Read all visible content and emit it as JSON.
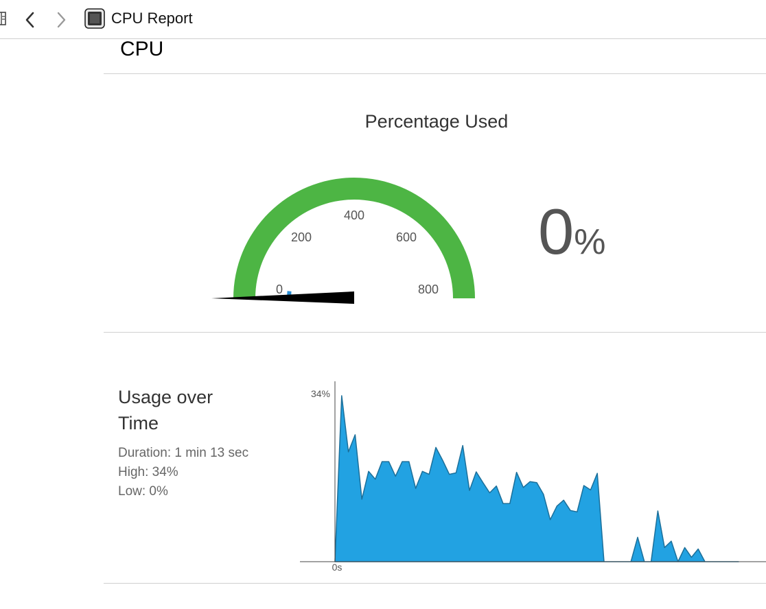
{
  "toolbar": {
    "breadcrumb": "CPU Report",
    "icons": [
      "sidebar-toggle-icon",
      "back-chevron-icon",
      "forward-chevron-icon",
      "cpu-chip-icon"
    ]
  },
  "section": {
    "title": "CPU"
  },
  "gauge": {
    "title": "Percentage Used",
    "min": 0,
    "max": 800,
    "ticks": [
      "0",
      "200",
      "400",
      "600",
      "800"
    ],
    "current_value": 0,
    "value_text": "0",
    "unit": "%",
    "arc_color": "#4db544",
    "needle_color": "#000000",
    "marker_color": "#2a8fd6"
  },
  "usage": {
    "title": "Usage over Time",
    "duration": "Duration: 1 min 13 sec",
    "high": "High: 34%",
    "low": "Low: 0%"
  },
  "chart_data": {
    "type": "area",
    "title": "",
    "xlabel": "",
    "ylabel": "",
    "x_tick_label": "0s",
    "y_tick_label": "34%",
    "ylim": [
      0,
      34
    ],
    "fill_color": "#22a2e2",
    "stroke_color": "#1b6f9a",
    "series": [
      {
        "values": [
          0,
          34,
          22.5,
          26,
          12.8,
          18.5,
          16.9,
          20.5,
          20.5,
          17.5,
          20.5,
          20.5,
          15,
          18.5,
          17.9,
          23.4,
          20.8,
          17.9,
          18.2,
          23.8,
          14.6,
          18.4,
          16.2,
          14.1,
          15.5,
          11.9,
          11.9,
          18.3,
          15.2,
          16.4,
          16.2,
          13.8,
          8.6,
          11.4,
          12.6,
          10.5,
          10.2,
          15.6,
          14.7,
          18.1,
          0,
          0,
          0,
          0,
          0,
          5,
          0,
          0,
          10.4,
          2.9,
          4.2,
          0,
          2.9,
          0.9,
          2.6,
          0,
          0,
          0,
          0,
          0,
          0
        ]
      }
    ]
  }
}
